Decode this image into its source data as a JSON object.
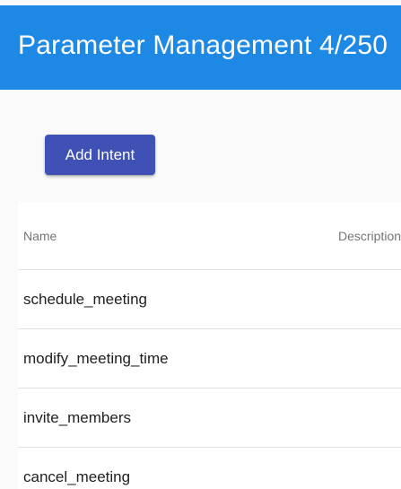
{
  "header": {
    "title": "Parameter Management 4/250",
    "color": "#1e88e5"
  },
  "toolbar": {
    "add_label": "Add Intent",
    "button_color": "#3f51b5"
  },
  "table": {
    "columns": [
      "Name",
      "Description"
    ],
    "rows": [
      {
        "name": "schedule_meeting"
      },
      {
        "name": "modify_meeting_time"
      },
      {
        "name": "invite_members"
      },
      {
        "name": "cancel_meeting"
      }
    ]
  }
}
